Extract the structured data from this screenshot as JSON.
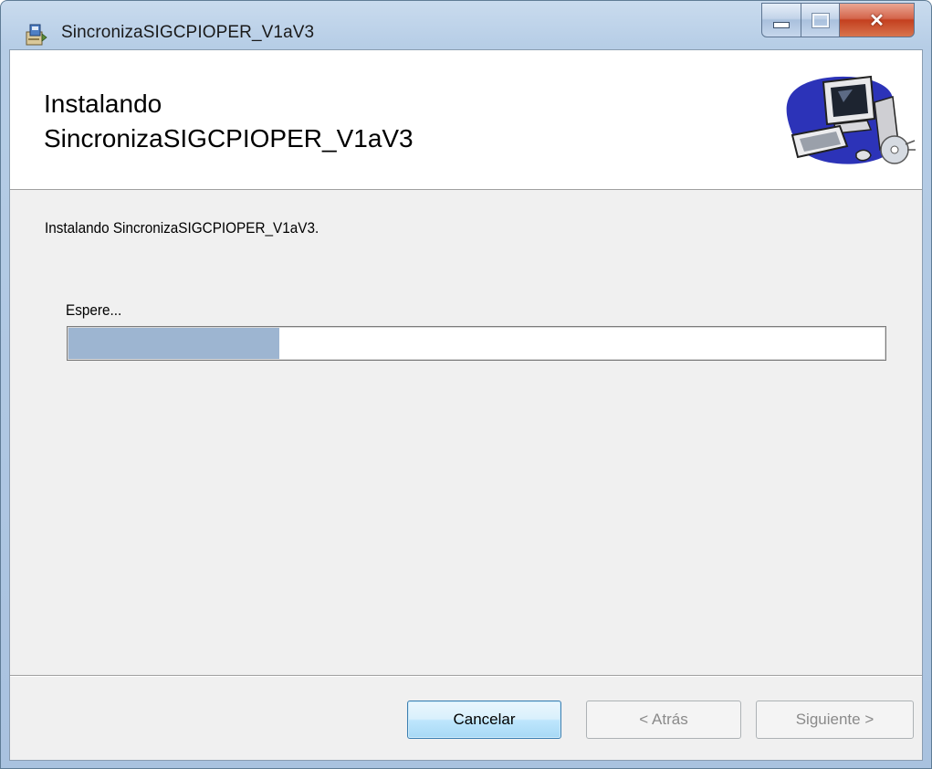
{
  "window": {
    "title": "SincronizaSIGCPIOPER_V1aV3",
    "app_icon": "installer-package-icon",
    "caption_buttons": {
      "minimize": "minimize-icon",
      "maximize": "maximize-icon",
      "close": "close-icon"
    }
  },
  "banner": {
    "title": "Instalando\nSincronizaSIGCPIOPER_V1aV3",
    "art_icon": "computer-setup-icon"
  },
  "content": {
    "status_text": "Instalando SincronizaSIGCPIOPER_V1aV3.",
    "progress_label": "Espere...",
    "progress_fraction": 0.26
  },
  "buttons": {
    "cancel_label": "Cancelar",
    "back_label": "< Atrás",
    "next_label": "Siguiente >"
  },
  "colors": {
    "progress_fill": "#9db5d1",
    "close_button": "#c4401f",
    "dialog_background": "#f0f0f0"
  }
}
